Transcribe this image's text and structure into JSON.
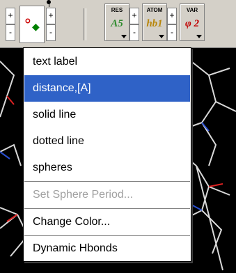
{
  "toolbar": {
    "plus": "+",
    "minus": "-",
    "res": {
      "caption": "RES",
      "value": "A5",
      "value_color": "#2e8b2e"
    },
    "atom": {
      "caption": "ATOM",
      "value": "hb1",
      "value_color": "#b8860b"
    },
    "var": {
      "caption": "VAR",
      "value": "φ 2",
      "value_color": "#c00000"
    }
  },
  "menu": {
    "items": [
      {
        "label": "text label",
        "state": "normal"
      },
      {
        "label": "distance,[A]",
        "state": "selected"
      },
      {
        "label": "solid line",
        "state": "normal"
      },
      {
        "label": "dotted line",
        "state": "normal"
      },
      {
        "label": "spheres",
        "state": "normal"
      },
      {
        "label": "Set Sphere Period...",
        "state": "disabled"
      },
      {
        "label": "Change Color...",
        "state": "normal"
      },
      {
        "label": "Dynamic Hbonds",
        "state": "normal"
      }
    ]
  }
}
